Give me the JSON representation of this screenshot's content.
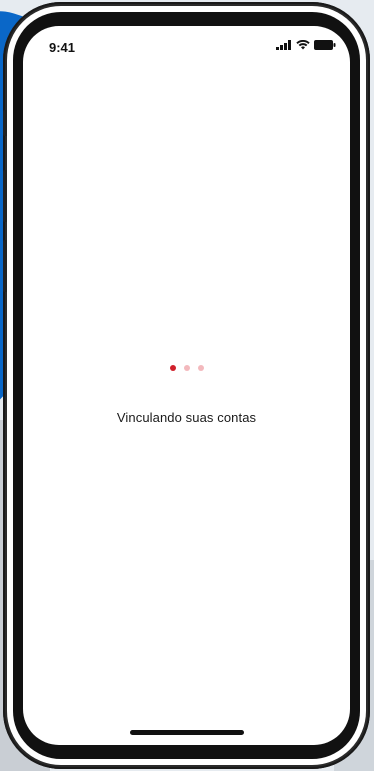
{
  "status_bar": {
    "time": "9:41",
    "icons": [
      "cellular-signal-icon",
      "wifi-icon",
      "battery-icon"
    ]
  },
  "loading": {
    "message": "Vinculando suas contas",
    "dots": [
      {
        "state": "active",
        "color": "#d0202b"
      },
      {
        "state": "inactive",
        "color": "#f3b9bd"
      },
      {
        "state": "inactive",
        "color": "#f3b9bd"
      }
    ]
  },
  "colors": {
    "accent": "#d0202b",
    "background_blue": "#0a67c8"
  }
}
